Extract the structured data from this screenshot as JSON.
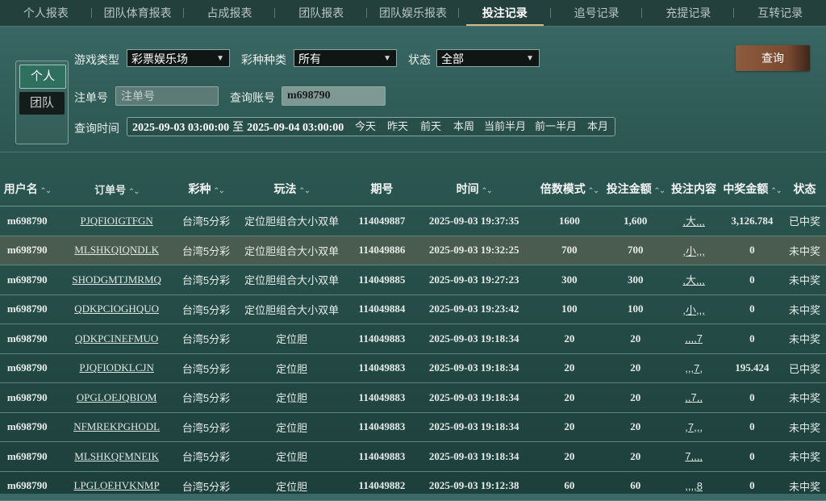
{
  "tabs": [
    {
      "label": "个人报表"
    },
    {
      "label": "团队体育报表"
    },
    {
      "label": "占成报表"
    },
    {
      "label": "团队报表"
    },
    {
      "label": "团队娱乐报表"
    },
    {
      "label": "投注记录",
      "active": true
    },
    {
      "label": "追号记录"
    },
    {
      "label": "充提记录"
    },
    {
      "label": "互转记录"
    }
  ],
  "scope": {
    "personal": "个人",
    "team": "团队",
    "selected": "个人"
  },
  "filters": {
    "game_type_label": "游戏类型",
    "game_type_value": "彩票娱乐场",
    "lottery_kind_label": "彩种种类",
    "lottery_kind_value": "所有",
    "status_label": "状态",
    "status_value": "全部",
    "order_no_label": "注单号",
    "order_no_placeholder": "注单号",
    "account_label": "查询账号",
    "account_value": "m698790",
    "time_label": "查询时间",
    "time_start": "2025-09-03 03:00:00",
    "time_sep": "至",
    "time_end": "2025-09-04 03:00:00",
    "quick_ranges": [
      "今天",
      "昨天",
      "前天",
      "本周",
      "当前半月",
      "前一半月",
      "本月"
    ]
  },
  "query_button": "查询",
  "table": {
    "headers": {
      "user": "用户名",
      "order": "订单号",
      "lottery": "彩种",
      "play": "玩法",
      "issue": "期号",
      "time": "时间",
      "multiple": "倍数模式",
      "amount": "投注金额",
      "content": "投注内容",
      "win": "中奖金额",
      "status": "状态"
    },
    "rows": [
      {
        "user": "m698790",
        "order": "PJQFIOIGTFGN",
        "lottery": "台湾5分彩",
        "play": "定位胆组合大小双单",
        "issue": "114049887",
        "time": "2025-09-03 19:37:35",
        "multiple": "1600",
        "amount": "1,600",
        "content": ",大,,,",
        "win": "3,126.784",
        "status": "已中奖"
      },
      {
        "user": "m698790",
        "order": "MLSHKQIQNDLK",
        "lottery": "台湾5分彩",
        "play": "定位胆组合大小双单",
        "issue": "114049886",
        "time": "2025-09-03 19:32:25",
        "multiple": "700",
        "amount": "700",
        "content": ",小,,,",
        "win": "0",
        "status": "未中奖"
      },
      {
        "user": "m698790",
        "order": "SHODGMTJMRMQ",
        "lottery": "台湾5分彩",
        "play": "定位胆组合大小双单",
        "issue": "114049885",
        "time": "2025-09-03 19:27:23",
        "multiple": "300",
        "amount": "300",
        "content": ",大,,,",
        "win": "0",
        "status": "未中奖"
      },
      {
        "user": "m698790",
        "order": "QDKPCIOGHQUO",
        "lottery": "台湾5分彩",
        "play": "定位胆组合大小双单",
        "issue": "114049884",
        "time": "2025-09-03 19:23:42",
        "multiple": "100",
        "amount": "100",
        "content": ",小,,,",
        "win": "0",
        "status": "未中奖"
      },
      {
        "user": "m698790",
        "order": "QDKPCINEFMUO",
        "lottery": "台湾5分彩",
        "play": "定位胆",
        "issue": "114049883",
        "time": "2025-09-03 19:18:34",
        "multiple": "20",
        "amount": "20",
        "content": ",,,,7",
        "win": "0",
        "status": "未中奖"
      },
      {
        "user": "m698790",
        "order": "PJQFIODKLCJN",
        "lottery": "台湾5分彩",
        "play": "定位胆",
        "issue": "114049883",
        "time": "2025-09-03 19:18:34",
        "multiple": "20",
        "amount": "20",
        "content": ",,,7,",
        "win": "195.424",
        "status": "已中奖"
      },
      {
        "user": "m698790",
        "order": "OPGLOEJQBIOM",
        "lottery": "台湾5分彩",
        "play": "定位胆",
        "issue": "114049883",
        "time": "2025-09-03 19:18:34",
        "multiple": "20",
        "amount": "20",
        "content": ",,7,,",
        "win": "0",
        "status": "未中奖"
      },
      {
        "user": "m698790",
        "order": "NFMREKPGHODL",
        "lottery": "台湾5分彩",
        "play": "定位胆",
        "issue": "114049883",
        "time": "2025-09-03 19:18:34",
        "multiple": "20",
        "amount": "20",
        "content": ",7,,,",
        "win": "0",
        "status": "未中奖"
      },
      {
        "user": "m698790",
        "order": "MLSHKQFMNEIK",
        "lottery": "台湾5分彩",
        "play": "定位胆",
        "issue": "114049883",
        "time": "2025-09-03 19:18:34",
        "multiple": "20",
        "amount": "20",
        "content": "7,,,,",
        "win": "0",
        "status": "未中奖"
      },
      {
        "user": "m698790",
        "order": "LPGLOEHVKNMP",
        "lottery": "台湾5分彩",
        "play": "定位胆",
        "issue": "114049882",
        "time": "2025-09-03 19:12:38",
        "multiple": "60",
        "amount": "60",
        "content": ",,,,8",
        "win": "0",
        "status": "未中奖"
      }
    ]
  },
  "colors": {
    "accent": "#d2b98a",
    "query_button": "#8d5b3d",
    "highlight_row": "#4a5b50"
  }
}
